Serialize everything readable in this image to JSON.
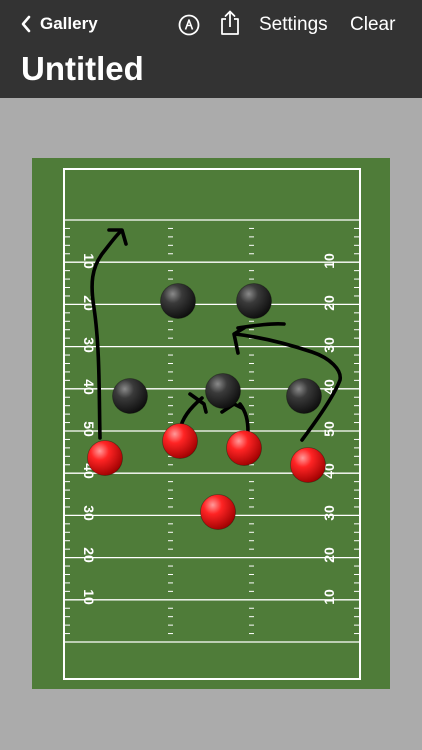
{
  "nav": {
    "back_label": "Gallery",
    "back_icon": "chevron-left-icon",
    "markup_icon": "markup-pen-icon",
    "share_icon": "share-icon",
    "settings_label": "Settings",
    "clear_label": "Clear"
  },
  "title": "Untitled",
  "colors": {
    "header": "#333333",
    "canvas_bg": "#ababab",
    "field": "#4f7c39",
    "lines": "#ffffff",
    "offense": "#e41414",
    "defense": "#2b2b2b",
    "drawing": "#000000"
  },
  "field": {
    "yard_labels_left": [
      "10",
      "20",
      "30",
      "40",
      "50",
      "40",
      "30",
      "20",
      "10"
    ],
    "yard_labels_right": [
      "10",
      "20",
      "30",
      "40",
      "50",
      "40",
      "30",
      "20",
      "10"
    ]
  },
  "players": {
    "offense_count": 5,
    "defense_count": 5
  }
}
